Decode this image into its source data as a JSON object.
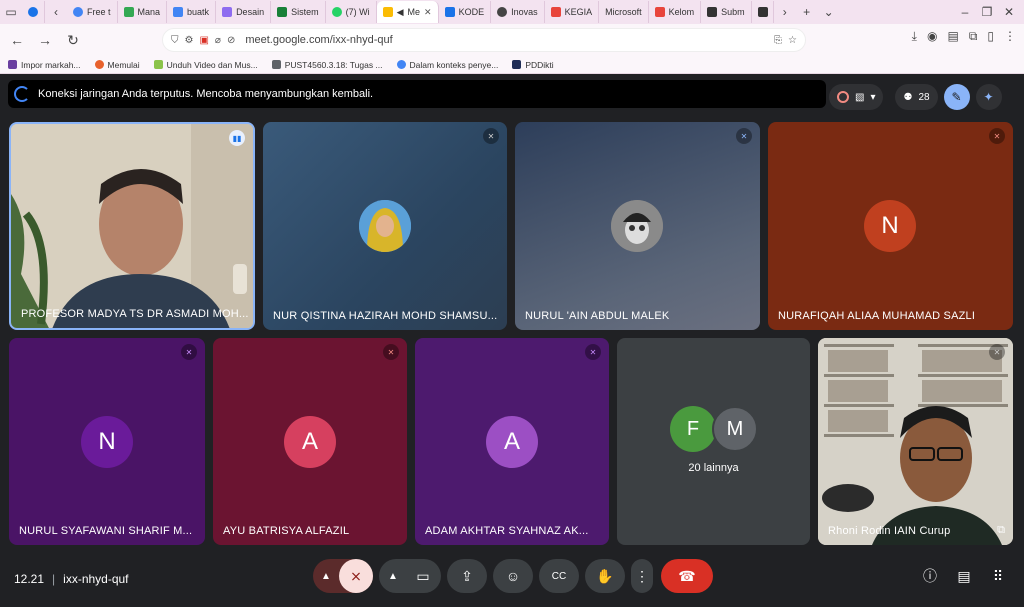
{
  "tabs": [
    {
      "label": "",
      "color": "#c58af9"
    },
    {
      "label": "",
      "color": "#1a73e8"
    },
    {
      "label": "Free t",
      "color": "#4285f4"
    },
    {
      "label": "Mana",
      "color": "#34a853"
    },
    {
      "label": "buatk",
      "color": "#4285f4"
    },
    {
      "label": "Desain",
      "color": "#8e6cf0"
    },
    {
      "label": "Sistem",
      "color": "#188038"
    },
    {
      "label": "(7) Wi",
      "color": "#25d366"
    },
    {
      "label": "Me",
      "color": "#fbbc04"
    },
    {
      "label": "KODE",
      "color": "#1a73e8"
    },
    {
      "label": "Inovas",
      "color": "#444444"
    },
    {
      "label": "KEGIA",
      "color": "#e8453c"
    },
    {
      "label": "Microsoft",
      "color": "#ffffff"
    },
    {
      "label": "Kelom",
      "color": "#e8453c"
    },
    {
      "label": "Subm",
      "color": "#333333"
    }
  ],
  "address": {
    "url": "meet.google.com/ixx-nhyd-quf"
  },
  "bookmarks": [
    {
      "label": "Impor markah...",
      "color": "#6a3fa0"
    },
    {
      "label": "Memulai",
      "color": "#e8612c"
    },
    {
      "label": "Unduh Video dan Mus...",
      "color": "#8bc34a"
    },
    {
      "label": "PUST4560.3.18: Tugas ...",
      "color": "#5f6368"
    },
    {
      "label": "Dalam konteks penye...",
      "color": "#4285f4"
    },
    {
      "label": "PDDikti",
      "color": "#1f2d56"
    }
  ],
  "banner": {
    "text": "Koneksi jaringan Anda terputus. Mencoba menyambungkan kembali."
  },
  "participants_count": "28",
  "tiles": [
    {
      "name": "PROFESOR MADYA TS DR ASMADI MOH...",
      "type": "video"
    },
    {
      "name": "NUR QISTINA HAZIRAH MOHD SHAMSU...",
      "type": "photo"
    },
    {
      "name": "NURUL 'AIN ABDUL MALEK",
      "type": "photo"
    },
    {
      "name": "NURAFIQAH ALIAA MUHAMAD SAZLI",
      "letter": "N",
      "bg": "#7a2a12",
      "avatar": "#c0401f"
    },
    {
      "name": "NURUL SYAFAWANI SHARIF M...",
      "letter": "N",
      "bg": "#4a1466",
      "avatar": "#6a1b9a"
    },
    {
      "name": "AYU BATRISYA ALFAZIL",
      "letter": "A",
      "bg": "#6b1431",
      "avatar": "#d6405f"
    },
    {
      "name": "ADAM AKHTAR SYAHNAZ AK...",
      "letter": "A",
      "bg": "#4d1a6e",
      "avatar": "#9c4fc4"
    },
    {
      "name": "Rhoni Rodin IAIN Curup",
      "type": "video"
    }
  ],
  "others": {
    "letters": [
      "F",
      "M"
    ],
    "label": "20 lainnya"
  },
  "bottom": {
    "time": "12.21",
    "separator": "|",
    "code": "ixx-nhyd-quf"
  }
}
